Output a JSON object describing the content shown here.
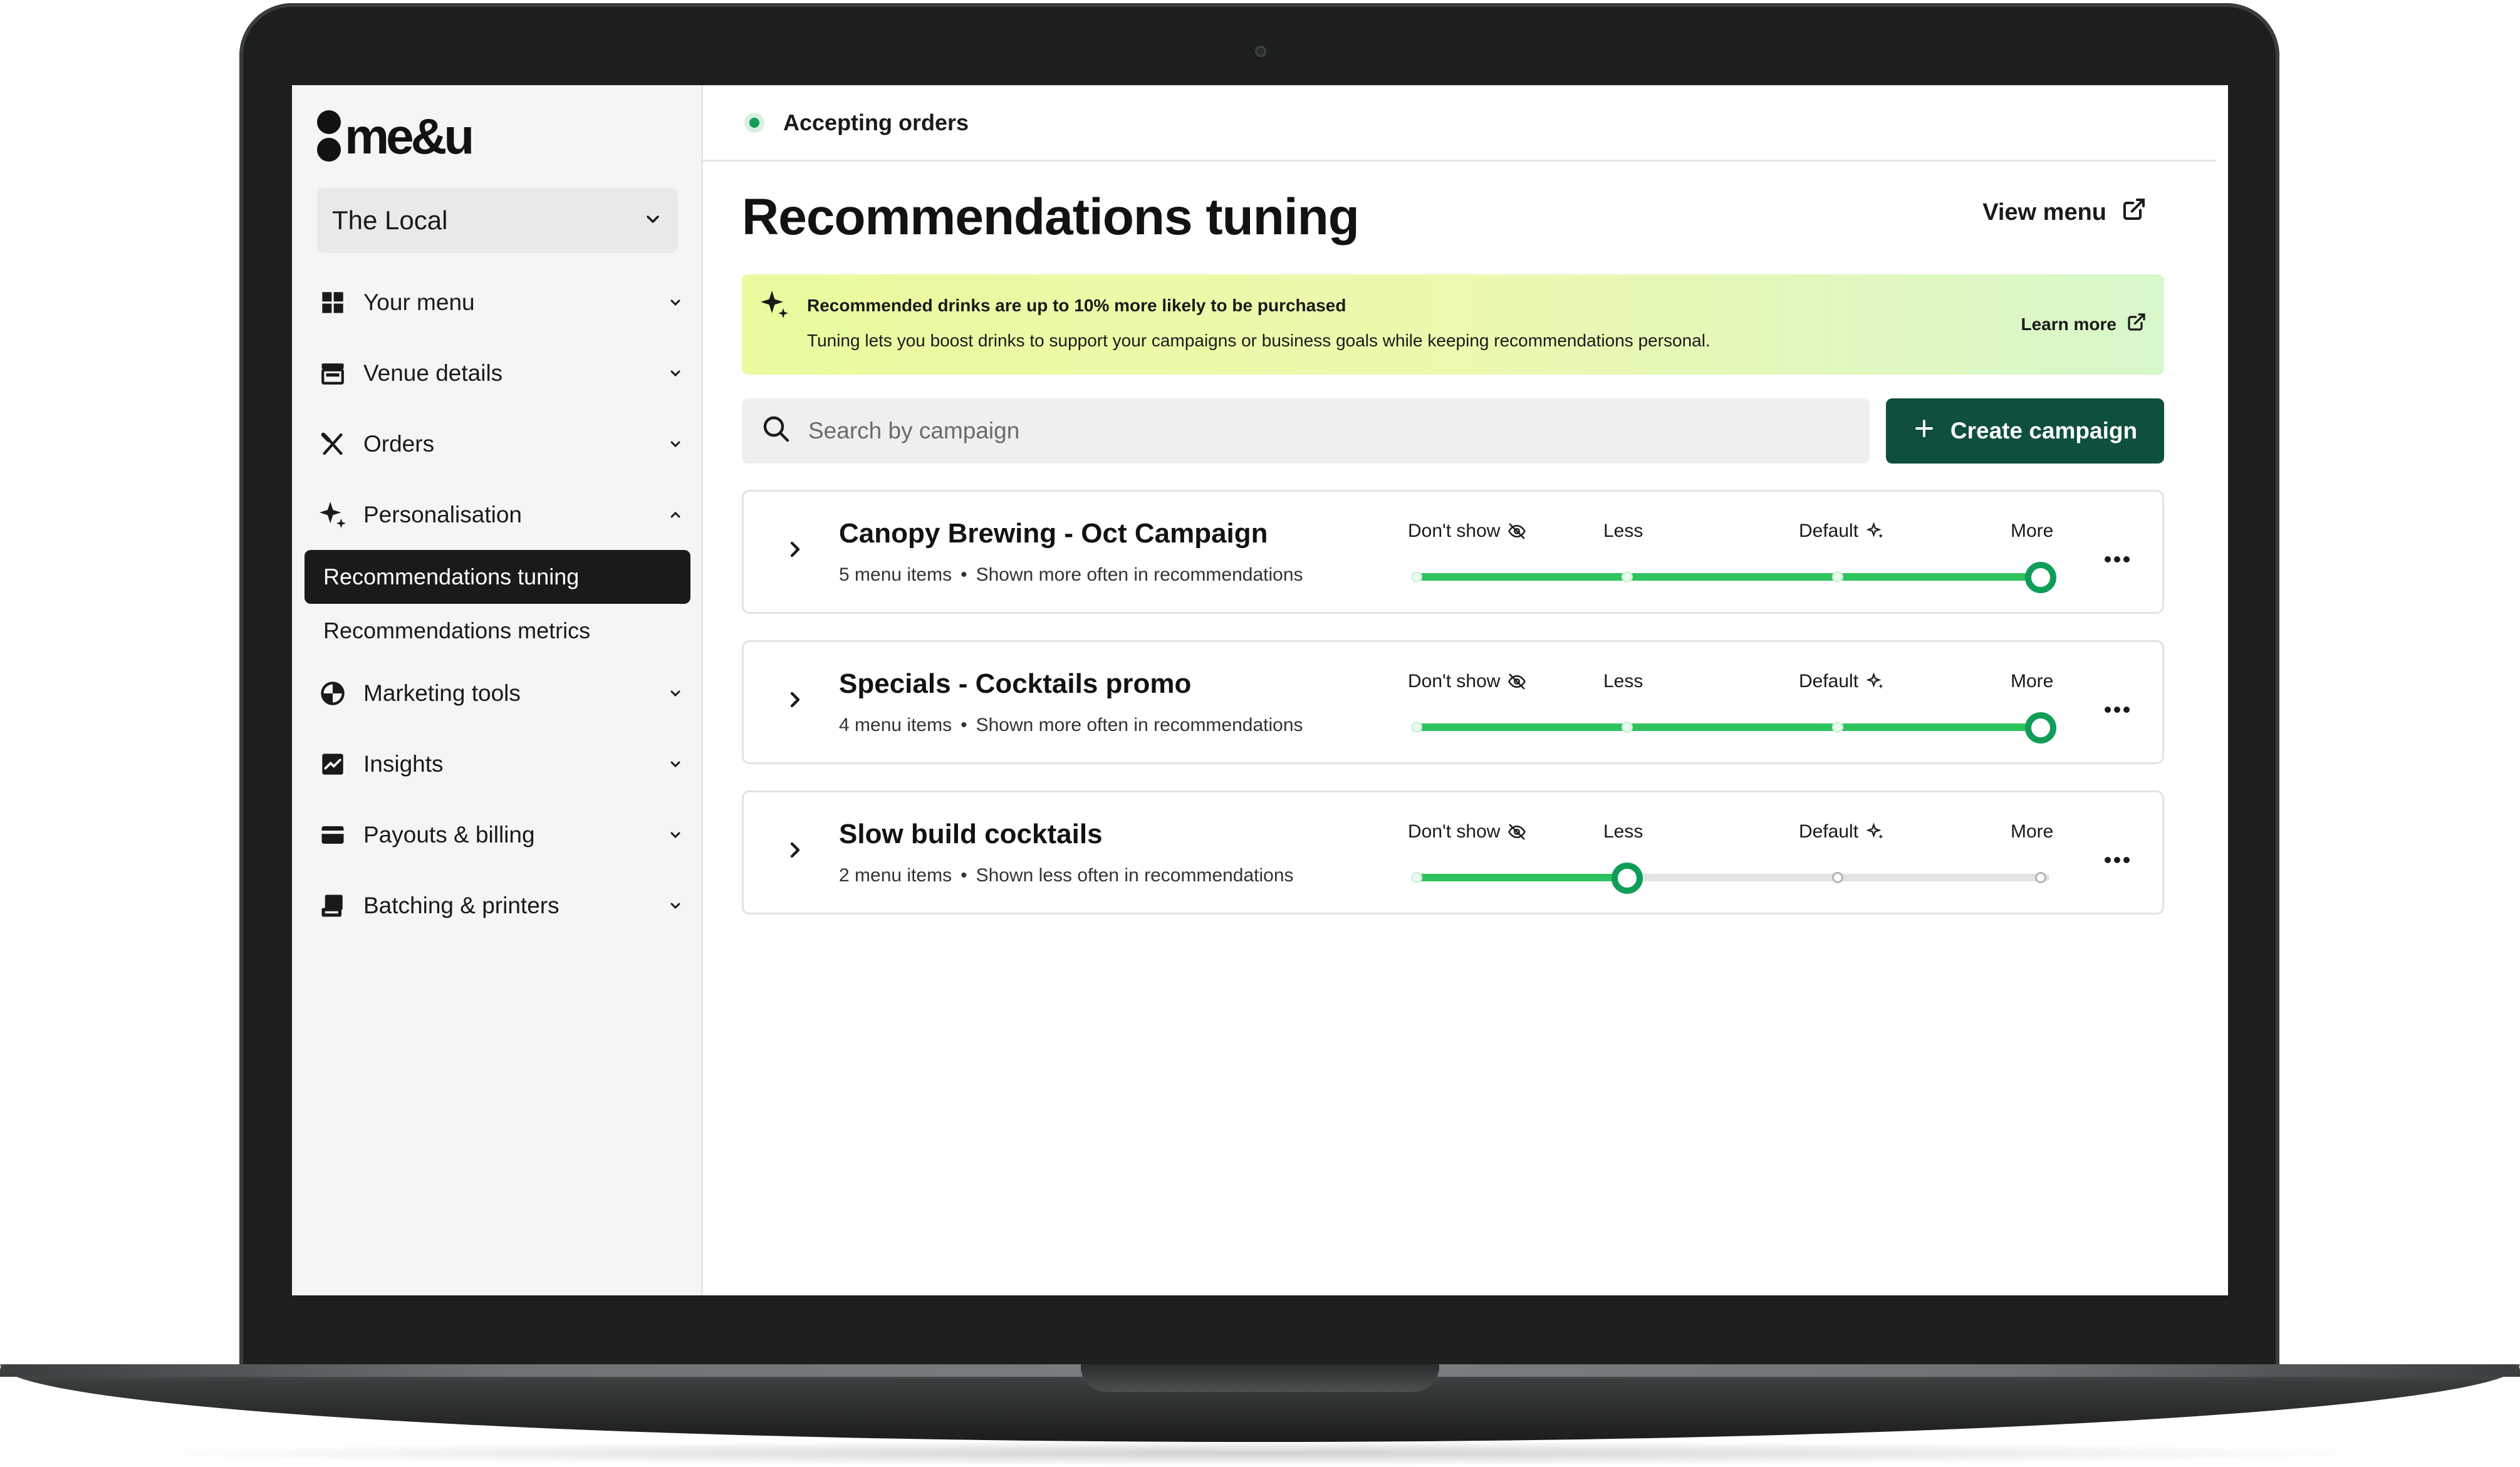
{
  "app": {
    "logo_text": "me&u"
  },
  "sidebar": {
    "venue": "The Local",
    "items": [
      {
        "label": "Your menu",
        "icon": "grid-icon"
      },
      {
        "label": "Venue details",
        "icon": "storefront-icon"
      },
      {
        "label": "Orders",
        "icon": "utensils-icon"
      },
      {
        "label": "Personalisation",
        "icon": "sparkle-icon",
        "expanded": true,
        "children": [
          {
            "label": "Recommendations tuning",
            "active": true
          },
          {
            "label": "Recommendations metrics",
            "active": false
          }
        ]
      },
      {
        "label": "Marketing tools",
        "icon": "pie-chart-icon"
      },
      {
        "label": "Insights",
        "icon": "trend-icon"
      },
      {
        "label": "Payouts & billing",
        "icon": "card-icon"
      },
      {
        "label": "Batching & printers",
        "icon": "printer-icon"
      }
    ]
  },
  "status": {
    "label": "Accepting orders",
    "color": "#0f9d58"
  },
  "header": {
    "title": "Recommendations tuning",
    "view_menu_label": "View menu"
  },
  "banner": {
    "title": "Recommended drinks are up to 10% more likely to be purchased",
    "text": "Tuning lets you boost drinks to support your campaigns or business goals while keeping recommendations personal.",
    "link_label": "Learn more"
  },
  "search": {
    "placeholder": "Search by campaign",
    "value": ""
  },
  "create_button": {
    "label": "Create campaign"
  },
  "tuning_levels": [
    "Don't show",
    "Less",
    "Default",
    "More"
  ],
  "campaigns": [
    {
      "name": "Canopy Brewing - Oct Campaign",
      "items": "5 menu items",
      "summary": "Shown more often in recommendations",
      "level_index": 3
    },
    {
      "name": "Specials - Cocktails promo",
      "items": "4 menu items",
      "summary": "Shown more often in recommendations",
      "level_index": 3
    },
    {
      "name": "Slow build cocktails",
      "items": "2 menu items",
      "summary": "Shown less often in recommendations",
      "level_index": 1
    }
  ],
  "colors": {
    "accent": "#0e4f3d",
    "slider_fill": "#2fc35f",
    "slider_knob": "#0f9d58",
    "banner_start": "#e9fb9e",
    "banner_end": "#d8f7cb"
  }
}
